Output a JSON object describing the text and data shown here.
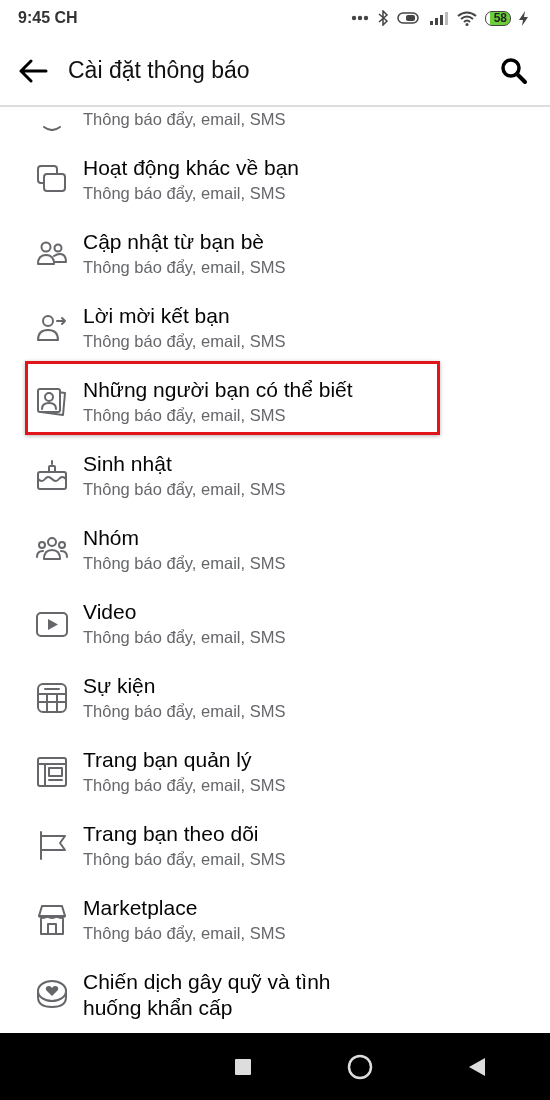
{
  "status_bar": {
    "time": "9:45 CH",
    "battery": "58"
  },
  "header": {
    "title": "Cài đặt thông báo"
  },
  "items": [
    {
      "subtitle": "Thông báo đẩy, email, SMS",
      "highlighted": false
    },
    {
      "title": "Hoạt động khác về bạn",
      "subtitle": "Thông báo đẩy, email, SMS",
      "highlighted": false
    },
    {
      "title": "Cập nhật từ bạn bè",
      "subtitle": "Thông báo đẩy, email, SMS",
      "highlighted": false
    },
    {
      "title": "Lời mời kết bạn",
      "subtitle": "Thông báo đẩy, email, SMS",
      "highlighted": false
    },
    {
      "title": "Những người bạn có thể biết",
      "subtitle": "Thông báo đẩy, email, SMS",
      "highlighted": true
    },
    {
      "title": "Sinh nhật",
      "subtitle": "Thông báo đẩy, email, SMS",
      "highlighted": false
    },
    {
      "title": "Nhóm",
      "subtitle": "Thông báo đẩy, email, SMS",
      "highlighted": false
    },
    {
      "title": "Video",
      "subtitle": "Thông báo đẩy, email, SMS",
      "highlighted": false
    },
    {
      "title": "Sự kiện",
      "subtitle": "Thông báo đẩy, email, SMS",
      "highlighted": false
    },
    {
      "title": "Trang bạn quản lý",
      "subtitle": "Thông báo đẩy, email, SMS",
      "highlighted": false
    },
    {
      "title": "Trang bạn theo dõi",
      "subtitle": "Thông báo đẩy, email, SMS",
      "highlighted": false
    },
    {
      "title": "Marketplace",
      "subtitle": "Thông báo đẩy, email, SMS",
      "highlighted": false
    },
    {
      "title": "Chiến dịch gây quỹ và tình huống khẩn cấp",
      "highlighted": false
    }
  ]
}
